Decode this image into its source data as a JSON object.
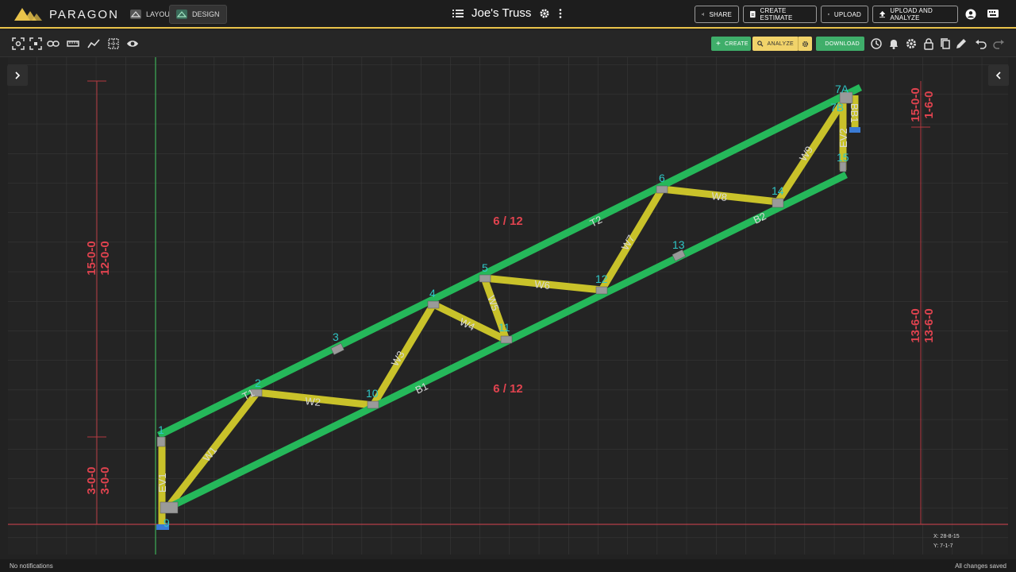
{
  "app": {
    "brand": "PARAGON",
    "modes": [
      {
        "label": "LAYOUT",
        "active": false
      },
      {
        "label": "DESIGN",
        "active": true
      }
    ],
    "title": "Joe's Truss"
  },
  "header_actions": {
    "share": "SHARE",
    "create_estimate": "CREATE ESTIMATE",
    "upload": "UPLOAD",
    "upload_and_analyze": "UPLOAD AND ANALYZE"
  },
  "toolbar": {
    "create": "CREATE",
    "analyze": "ANALYZE",
    "download": "DOWNLOAD"
  },
  "colors": {
    "chord": "#25b85a",
    "web": "#c9c22a",
    "node_label": "#2fc6c6",
    "dimension": "#e0434f",
    "accent": "#e9c34a",
    "create": "#3fae6a",
    "download": "#3fae6a",
    "analyze": "#f1d36a"
  },
  "truss": {
    "pitch_top": "6 / 12",
    "pitch_bottom": "6 / 12",
    "nodes": [
      {
        "label": "1"
      },
      {
        "label": "2"
      },
      {
        "label": "3"
      },
      {
        "label": "4"
      },
      {
        "label": "5"
      },
      {
        "label": "6"
      },
      {
        "label": "7A"
      },
      {
        "label": "7B"
      },
      {
        "label": "9"
      },
      {
        "label": "10"
      },
      {
        "label": "11"
      },
      {
        "label": "12"
      },
      {
        "label": "13"
      },
      {
        "label": "14"
      },
      {
        "label": "15"
      }
    ],
    "members": [
      {
        "label": "T1"
      },
      {
        "label": "T2"
      },
      {
        "label": "B1"
      },
      {
        "label": "B2"
      },
      {
        "label": "W1"
      },
      {
        "label": "W2"
      },
      {
        "label": "W3"
      },
      {
        "label": "W4"
      },
      {
        "label": "W5"
      },
      {
        "label": "W6"
      },
      {
        "label": "W7"
      },
      {
        "label": "W8"
      },
      {
        "label": "W9"
      },
      {
        "label": "EV1"
      },
      {
        "label": "EV2"
      },
      {
        "label": "BB1"
      }
    ],
    "dimensions": {
      "left_outer_top": "15-0-0",
      "left_inner_top": "12-0-0",
      "left_outer_bottom": "3-0-0",
      "left_inner_bottom": "3-0-0",
      "right_outer_top": "15-0-0",
      "right_inner_top": "1-6-0",
      "right_outer_bottom": "13-6-0",
      "right_inner_bottom": "13-6-0"
    }
  },
  "cursor": {
    "x": "X: 28-8-15",
    "y": "Y: 7-1-7"
  },
  "status": {
    "notifications": "No notifications",
    "save": "All changes saved"
  }
}
